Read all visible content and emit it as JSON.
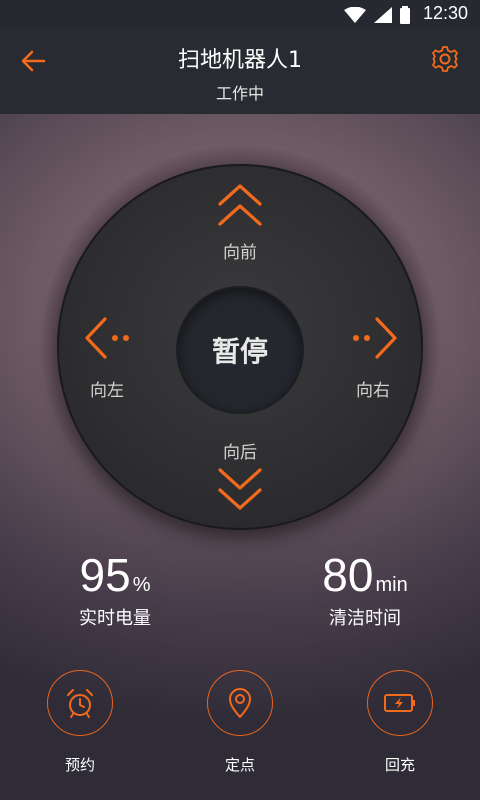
{
  "status_bar": {
    "time": "12:30",
    "icons": [
      "wifi-icon",
      "signal-icon",
      "battery-icon"
    ]
  },
  "header": {
    "title": "扫地机器人1",
    "subtitle": "工作中",
    "accent_color": "#f26a1b"
  },
  "control_pad": {
    "forward_label": "向前",
    "left_label": "向左",
    "right_label": "向右",
    "back_label": "向后",
    "center_label": "暂停"
  },
  "stats": {
    "battery": {
      "value": "95",
      "unit": "%",
      "label": "实时电量"
    },
    "clean_time": {
      "value": "80",
      "unit": "min",
      "label": "清洁时间"
    }
  },
  "actions": {
    "schedule": {
      "label": "预约",
      "icon": "alarm-clock-icon"
    },
    "spot": {
      "label": "定点",
      "icon": "location-pin-icon"
    },
    "recharge": {
      "label": "回充",
      "icon": "battery-charging-icon"
    }
  }
}
